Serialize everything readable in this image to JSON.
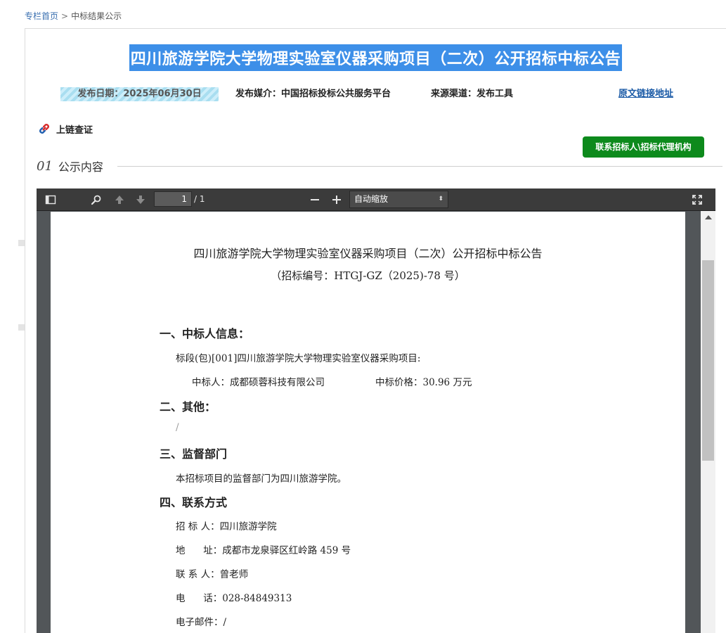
{
  "breadcrumb": {
    "home": "专栏首页",
    "separator": ">",
    "current": "中标结果公示"
  },
  "title": "四川旅游学院大学物理实验室仪器采购项目（二次）公开招标中标公告",
  "meta": {
    "date": "发布日期：2025年06月30日",
    "media": "发布媒介：中国招标投标公共服务平台",
    "source": "来源渠道：发布工具",
    "original_link": "原文链接地址"
  },
  "chain_verify": "上链查证",
  "contact_button": "联系招标人\\招标代理机构",
  "section": {
    "number": "01",
    "title": "公示内容"
  },
  "viewer": {
    "page_current": "1",
    "page_total": "/ 1",
    "zoom": "自动缩放",
    "colors": {
      "toolbar": "#3b3b3b",
      "background": "#525659"
    }
  },
  "document": {
    "title": "四川旅游学院大学物理实验室仪器采购项目（二次）公开招标中标公告",
    "subtitle": "（招标编号：HTGJ-GZ（2025)-78 号）",
    "s1_heading": "一、中标人信息：",
    "s1_lot": "标段(包)[001]四川旅游学院大学物理实验室仪器采购项目:",
    "s1_winner": "中标人：成都硕蓉科技有限公司",
    "s1_price": "中标价格：30.96 万元",
    "s2_heading": "二、其他：",
    "s2_text": "/",
    "s3_heading": "三、监督部门",
    "s3_text": "本招标项目的监督部门为四川旅游学院。",
    "s4_heading": "四、联系方式",
    "contacts": [
      "招 标 人：四川旅游学院",
      "地      址：成都市龙泉驿区红岭路 459 号",
      "联 系 人：曾老师",
      "电      话：028-84849313",
      "电子邮件：/"
    ]
  }
}
